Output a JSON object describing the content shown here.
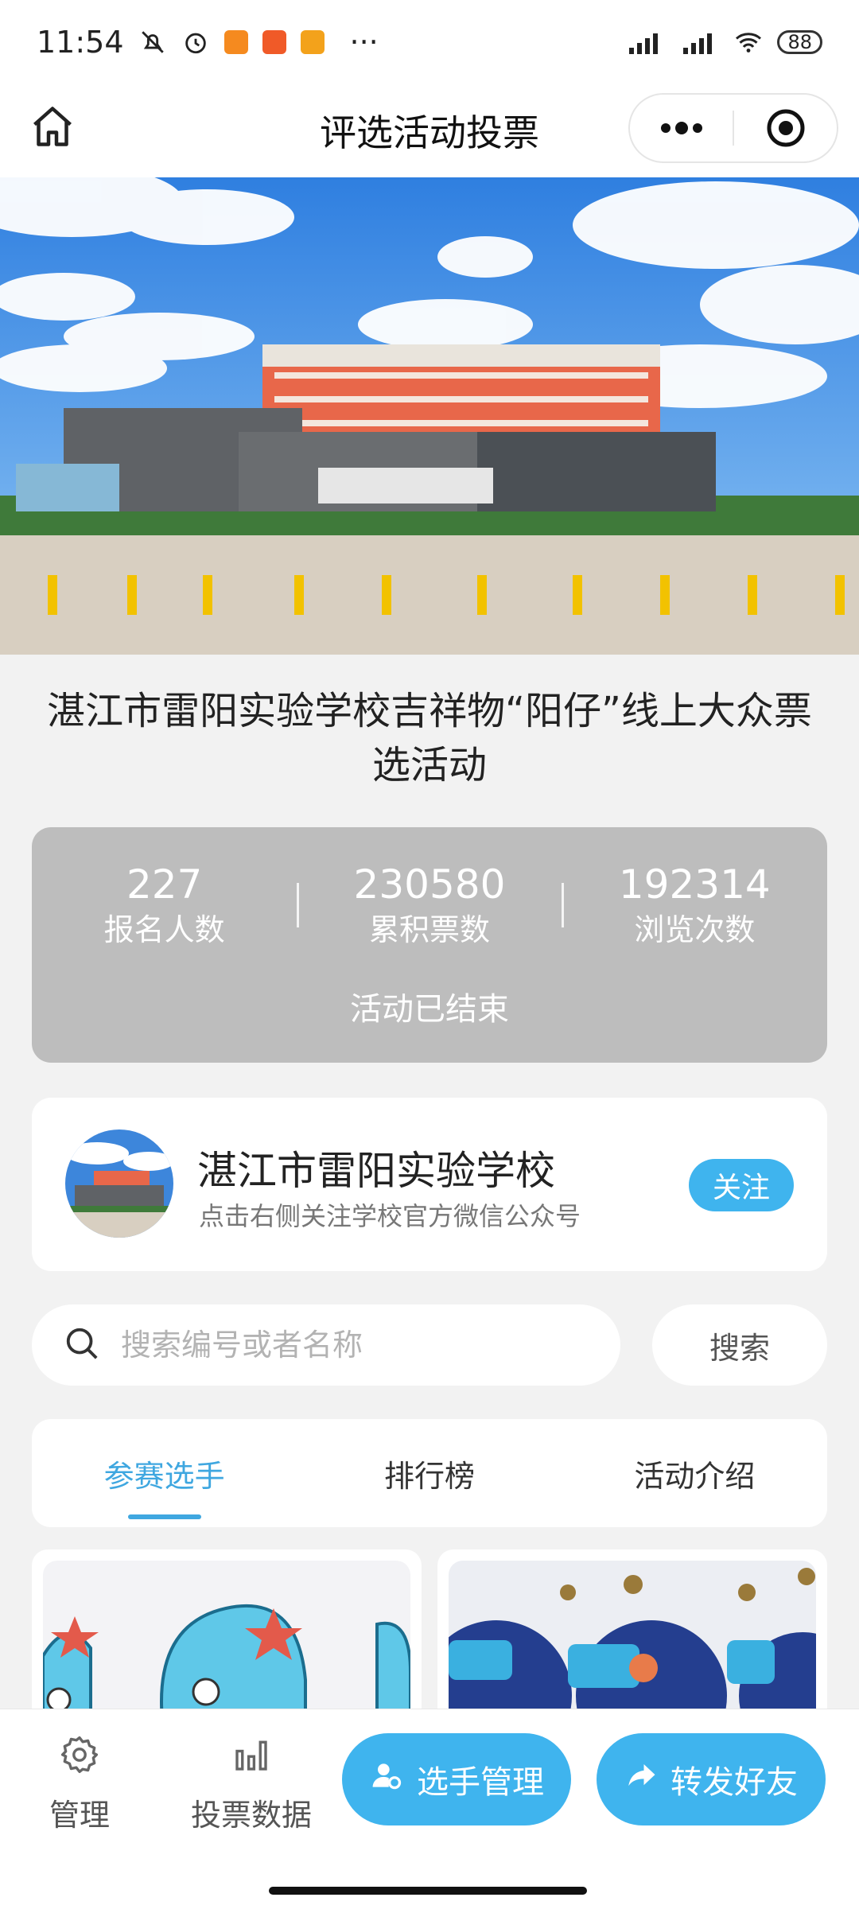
{
  "status_bar": {
    "time": "11:54",
    "more": "···",
    "battery": "88"
  },
  "nav": {
    "title": "评选活动投票"
  },
  "activity": {
    "title": "湛江市雷阳实验学校吉祥物“阳仔”线上大众票选活动"
  },
  "stats": {
    "items": [
      {
        "value": "227",
        "label": "报名人数"
      },
      {
        "value": "230580",
        "label": "累积票数"
      },
      {
        "value": "192314",
        "label": "浏览次数"
      }
    ],
    "status": "活动已结束"
  },
  "account": {
    "name": "湛江市雷阳实验学校",
    "desc": "点击右侧关注学校官方微信公众号",
    "follow_label": "关注"
  },
  "search": {
    "placeholder": "搜索编号或者名称",
    "button_label": "搜索"
  },
  "tabs": [
    {
      "label": "参赛选手",
      "active": true
    },
    {
      "label": "排行榜",
      "active": false
    },
    {
      "label": "活动介绍",
      "active": false
    }
  ],
  "bottom_bar": {
    "manage_label": "管理",
    "data_label": "投票数据",
    "contestant_manage_label": "选手管理",
    "share_label": "转发好友"
  },
  "colors": {
    "accent": "#3fb4ee",
    "tab_active": "#3fa7e0",
    "stats_bg": "#bdbdbd"
  }
}
